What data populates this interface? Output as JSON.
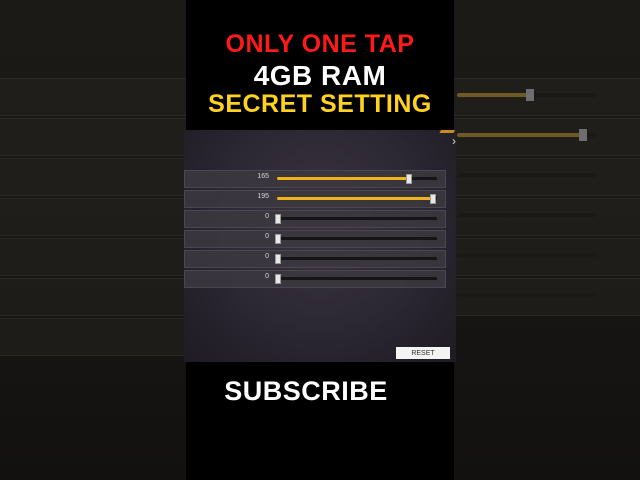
{
  "overlay": {
    "line1": "ONLY ONE TAP",
    "line2": "4GB RAM",
    "line3": "SECRET SETTING",
    "subscribe": "SUBSCRIBE"
  },
  "panel": {
    "sliders": [
      {
        "value": "165",
        "fraction": 0.82
      },
      {
        "value": "195",
        "fraction": 0.97
      },
      {
        "value": "0",
        "fraction": 0.0
      },
      {
        "value": "0",
        "fraction": 0.0
      },
      {
        "value": "0",
        "fraction": 0.0
      },
      {
        "value": "0",
        "fraction": 0.0
      }
    ],
    "reset_label": "RESET"
  },
  "background_sliders": [
    {
      "fraction": 0.52
    },
    {
      "fraction": 0.9
    }
  ],
  "colors": {
    "headline_red": "#ff1a1a",
    "headline_yellow": "#ffd21f",
    "slider_fill": "#f1b41b",
    "panel_bg": "#2b2733"
  },
  "icons": {
    "close_arrow": "chevron-right-icon"
  }
}
